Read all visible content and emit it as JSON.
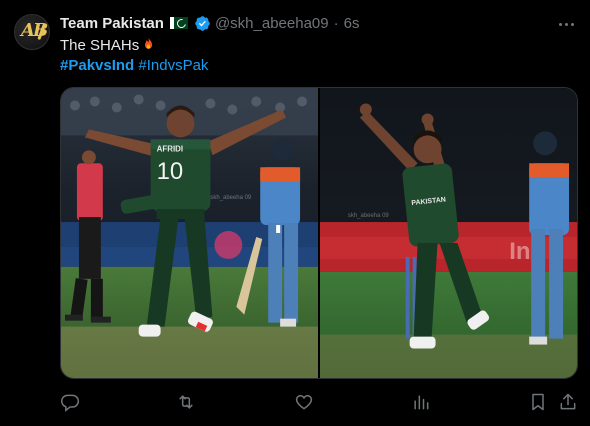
{
  "author": {
    "display_name": "Team Pakistan",
    "handle": "@skh_abeeha09",
    "time": "6s",
    "separator": "·",
    "avatar_monogram": "AB"
  },
  "tweet": {
    "text": "The SHAHs",
    "hashtags": [
      "#PakvsInd",
      "#IndvsPak"
    ]
  },
  "media": {
    "photos": [
      {
        "jersey_text": "AFRIDI",
        "jersey_number": "10",
        "watermark": "skh_abeeha 09"
      },
      {
        "jersey_text": "PAKISTAN",
        "watermark": "skh_abeeha 09"
      }
    ]
  },
  "colors": {
    "link": "#1d9bf0",
    "muted": "#71767b",
    "pak_green": "#1f4a2e",
    "ind_blue": "#4a86c8"
  },
  "icons": [
    "reply-icon",
    "retweet-icon",
    "like-icon",
    "views-icon",
    "bookmark-icon",
    "share-icon",
    "verified-icon",
    "flag-icon",
    "fire-icon",
    "more-icon"
  ]
}
